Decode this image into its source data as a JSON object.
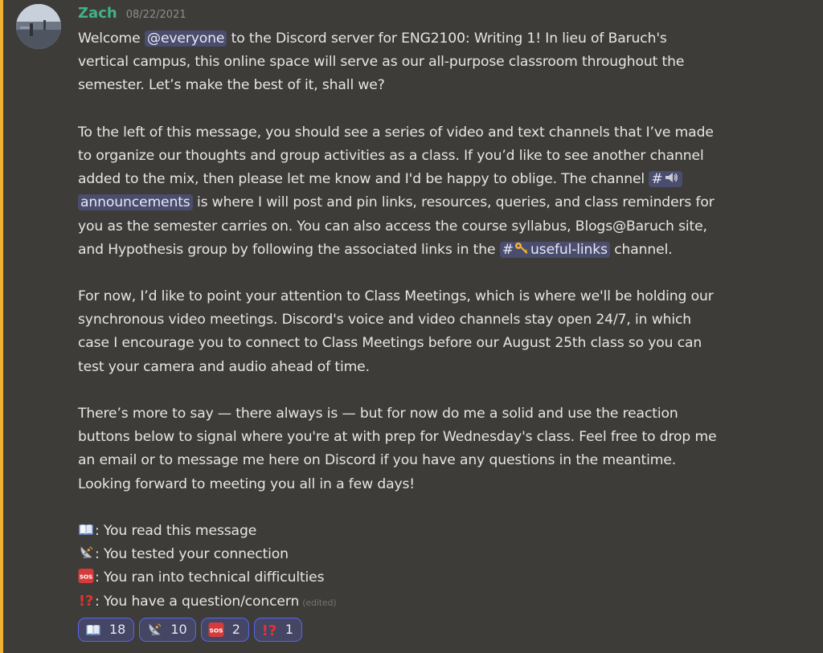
{
  "message": {
    "author": "Zach",
    "timestamp": "08/22/2021",
    "edited_label": "(edited)",
    "mention": "@everyone",
    "channels": {
      "announcements": "announcements",
      "useful_links": "useful-links",
      "hash": "#"
    },
    "p1": {
      "l1_pre": "Welcome",
      "l1_post": "to the Discord server for ENG2100: Writing 1! In lieu of Baruch's",
      "l2": "vertical campus, this online space will serve as our all-purpose classroom throughout the",
      "l3": "semester. Let’s make the best of it, shall we?"
    },
    "p2": {
      "l1": "To the left of this message, you should see a series of video and text channels that I’ve made",
      "l2": "to organize our thoughts and group activities as a class. If you’d like to see another channel",
      "l3_pre": "added to the mix, then please let me know and I'd be happy to oblige. The channel",
      "l4_post": "is where I will post and pin links, resources, queries, and class reminders for",
      "l5": "you as the semester carries on. You can also access the course syllabus, Blogs@Baruch site,",
      "l6_pre": "and Hypothesis group by following the associated links in the",
      "l6_post": "channel."
    },
    "p3": {
      "l1": "For now, I’d like to point your attention to Class Meetings, which is where we'll be holding our",
      "l2": "synchronous video meetings. Discord's voice and video channels stay open 24/7, in which",
      "l3": "case I encourage you to connect to Class Meetings before our August 25th class so you can",
      "l4": "test your camera and audio ahead of time."
    },
    "p4": {
      "l1": "There’s more to say — there always is — but for now do me a solid and use the reaction",
      "l2": "buttons below to signal where you're at with prep for Wednesday's class. Feel free to drop me",
      "l3": "an email or to message me here on Discord if you have any questions in the meantime.",
      "l4": "Looking forward to meeting you all in a few days!"
    },
    "legend": [
      {
        "icon": "open-book-icon",
        "text": ": You read this message"
      },
      {
        "icon": "satellite-dish-icon",
        "text": ": You tested your connection"
      },
      {
        "icon": "sos-icon",
        "text": ": You ran into technical difficulties"
      },
      {
        "icon": "interrobang-icon",
        "text": ": You have a question/concern"
      }
    ]
  },
  "reactions": [
    {
      "icon": "open-book-icon",
      "count": "18"
    },
    {
      "icon": "satellite-dish-icon",
      "count": "10"
    },
    {
      "icon": "sos-icon",
      "count": "2"
    },
    {
      "icon": "interrobang-icon",
      "count": "1"
    }
  ],
  "colors": {
    "background": "#3e3c39",
    "username": "#3fb28b",
    "mention_bg": "#4a4d6d",
    "reaction_border": "#5865f2",
    "accent_bar": "#f0b232"
  }
}
